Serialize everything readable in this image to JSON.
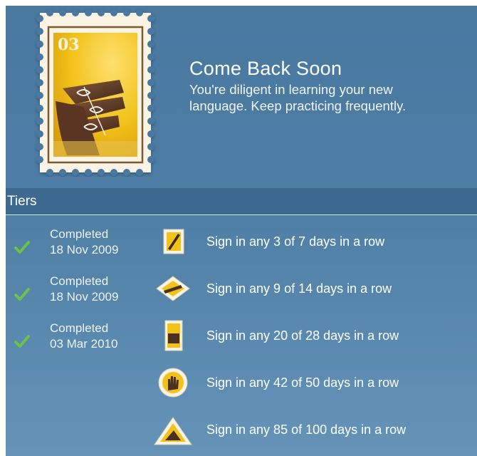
{
  "badge": {
    "stamp_number": "03",
    "title": "Come Back Soon",
    "description": "You're diligent in learning your new language. Keep practicing frequently."
  },
  "tiers": {
    "header": "Tiers",
    "rows": [
      {
        "status": "Completed",
        "date": "18 Nov 2009",
        "requirement": "Sign in any 3 of 7 days in a row",
        "icon": "stamp-pencil-icon",
        "completed": true
      },
      {
        "status": "Completed",
        "date": "18 Nov 2009",
        "requirement": "Sign in any 9 of 14 days in a row",
        "icon": "stamp-diamond-icon",
        "completed": true
      },
      {
        "status": "Completed",
        "date": "03 Mar 2010",
        "requirement": "Sign in any 20 of 28 days in a row",
        "icon": "stamp-portrait-icon",
        "completed": true
      },
      {
        "status": "",
        "date": "",
        "requirement": "Sign in any 42 of 50 days in a row",
        "icon": "stamp-round-hand-icon",
        "completed": false
      },
      {
        "status": "",
        "date": "",
        "requirement": "Sign in any 85 of 100 days in a row",
        "icon": "stamp-triangle-icon",
        "completed": false
      }
    ]
  },
  "colors": {
    "panel": "#4a79a0",
    "tiers_bar": "#3e6a91",
    "check": "#6cc24a",
    "stamp_paper": "#fbf4e4",
    "stamp_image": "#f2c21a"
  }
}
